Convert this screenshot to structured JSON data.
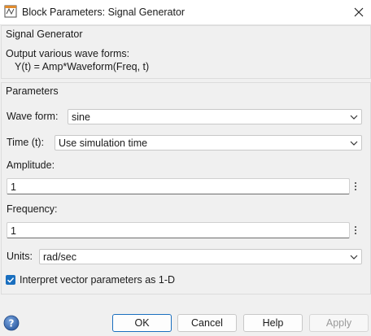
{
  "window": {
    "title": "Block Parameters: Signal Generator",
    "close_glyph": "✕"
  },
  "description": {
    "title": "Signal Generator",
    "line1": "Output various wave forms:",
    "line2": "Y(t) = Amp*Waveform(Freq, t)"
  },
  "parameters": {
    "title": "Parameters",
    "wave_form": {
      "label": "Wave form:",
      "value": "sine"
    },
    "time": {
      "label": "Time (t):",
      "value": "Use simulation time"
    },
    "amplitude": {
      "label": "Amplitude:",
      "value": "1"
    },
    "frequency": {
      "label": "Frequency:",
      "value": "1"
    },
    "units": {
      "label": "Units:",
      "value": "rad/sec"
    },
    "interpret_vector": {
      "label": "Interpret vector parameters as 1-D",
      "checked": true
    }
  },
  "buttons": {
    "ok": "OK",
    "cancel": "Cancel",
    "help": "Help",
    "apply": "Apply"
  },
  "icons": {
    "app": "simulink-block-icon",
    "close": "close-icon",
    "help": "help-icon",
    "chevron": "chevron-down-icon",
    "kebab": "kebab-menu-icon",
    "check": "checkmark-icon"
  },
  "colors": {
    "accent": "#1a6fbf",
    "window_bg": "#f0f0f0",
    "titlebar_bg": "#ffffff"
  }
}
